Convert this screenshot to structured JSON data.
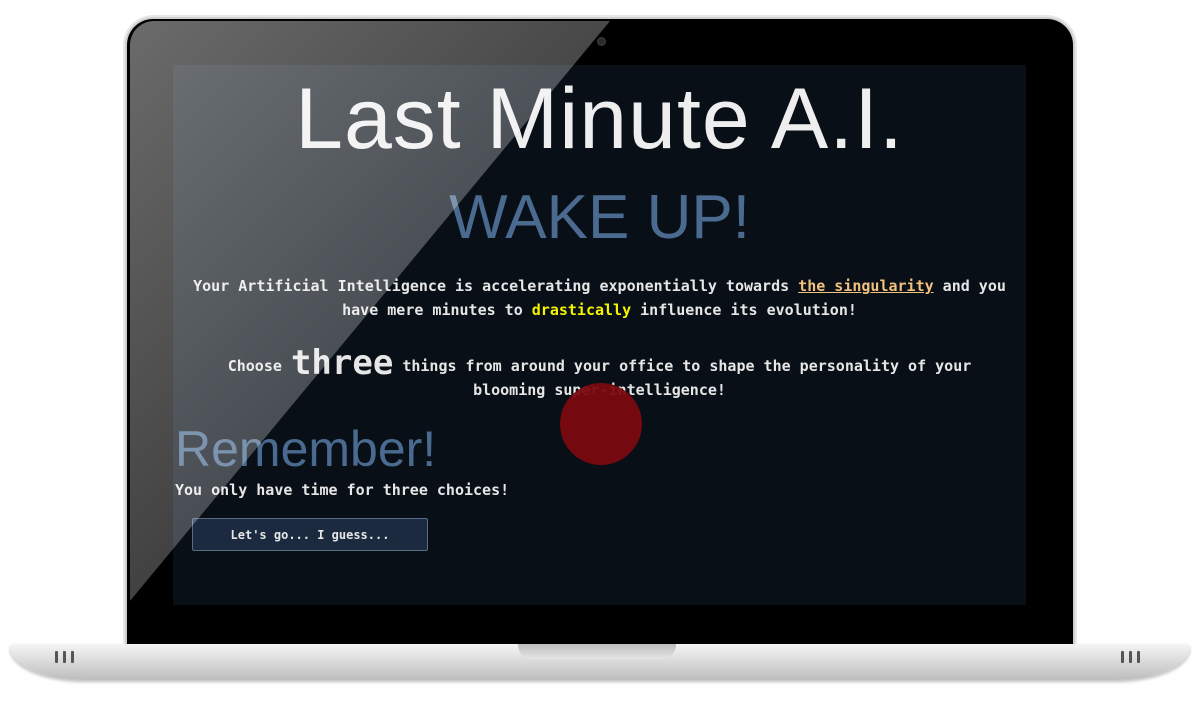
{
  "screen": {
    "title": "Last Minute A.I.",
    "heading": "WAKE UP!",
    "intro": {
      "part1": "Your Artificial Intelligence is accelerating exponentially towards ",
      "link_text": "the singularity",
      "part2": " and you have mere minutes to ",
      "highlight": "drastically",
      "part3": " influence its evolution!"
    },
    "choose": {
      "part1": "Choose ",
      "big_word": "three",
      "part2": " things from around your office to shape the personality of your blooming super-intelligence!"
    },
    "remember_heading": "Remember!",
    "remember_text": "You only have time for three choices!",
    "start_button_label": "Let's go... I guess..."
  },
  "colors": {
    "background": "#080f17",
    "accent_blue": "#4a6b8f",
    "link": "#f1c27d",
    "highlight": "#f4f400",
    "cursor_marker": "#7a0b10"
  }
}
